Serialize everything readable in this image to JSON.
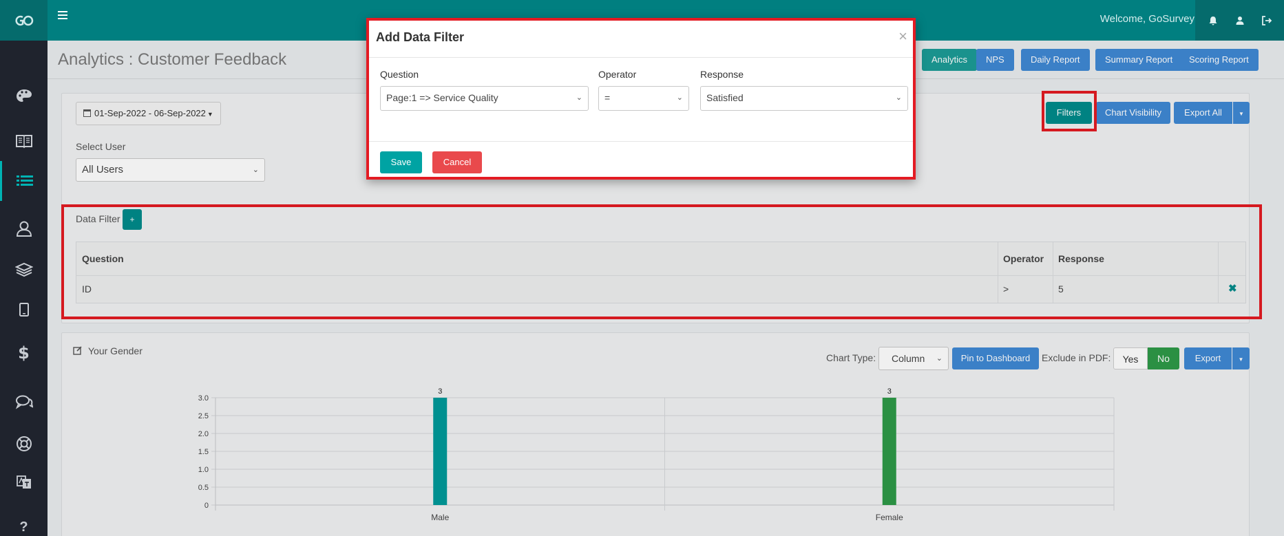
{
  "header": {
    "welcome": "Welcome, GoSurvey"
  },
  "sidebar": {
    "items": [
      {
        "icon": "palette-icon"
      },
      {
        "icon": "book-icon"
      },
      {
        "icon": "list-icon",
        "active": true
      },
      {
        "icon": "user-icon"
      },
      {
        "icon": "layers-icon"
      },
      {
        "icon": "tablet-icon"
      },
      {
        "icon": "dollar-icon"
      },
      {
        "icon": "chat-icon"
      },
      {
        "icon": "lifebuoy-icon"
      },
      {
        "icon": "translate-icon"
      },
      {
        "icon": "question-icon"
      }
    ]
  },
  "page": {
    "title": "Analytics : Customer Feedback",
    "buttons": {
      "analytics": "Analytics",
      "nps": "NPS",
      "daily_report": "Daily Report",
      "summary_report": "Summary Report",
      "scoring_report": "Scoring Report"
    }
  },
  "filters_panel": {
    "date_range": "01-Sep-2022 - 06-Sep-2022",
    "select_user_label": "Select User",
    "select_user_value": "All Users",
    "filters_btn": "Filters",
    "chart_visibility_btn": "Chart Visibility",
    "export_all_btn": "Export All",
    "data_filter_label": "Data Filter",
    "add_btn": "+",
    "table": {
      "headers": [
        "Question",
        "Operator",
        "Response"
      ],
      "rows": [
        {
          "question": "ID",
          "operator": ">",
          "response": "5"
        }
      ]
    }
  },
  "chart_panel": {
    "title": "Your Gender",
    "chart_type_label": "Chart Type:",
    "chart_type_value": "Column",
    "pin_btn": "Pin to Dashboard",
    "exclude_label": "Exclude in PDF:",
    "yes": "Yes",
    "no": "No",
    "export_btn": "Export"
  },
  "chart_data": {
    "type": "bar",
    "categories": [
      "Male",
      "Female"
    ],
    "values": [
      3,
      3
    ],
    "colors": [
      "#009999",
      "#2e9a48"
    ],
    "ylim": [
      0,
      3
    ],
    "yticks": [
      "3.0",
      "2.5",
      "2.0",
      "1.5",
      "1.0",
      "0.5",
      "0"
    ],
    "ytick_values": [
      3,
      2.5,
      2,
      1.5,
      1,
      0.5,
      0
    ],
    "data_labels": [
      "3",
      "3"
    ]
  },
  "modal": {
    "title": "Add Data Filter",
    "close": "×",
    "question_label": "Question",
    "question_value": "Page:1 => Service Quality",
    "operator_label": "Operator",
    "operator_value": "=",
    "response_label": "Response",
    "response_value": "Satisfied",
    "save": "Save",
    "cancel": "Cancel"
  },
  "colors": {
    "primary": "#017f80",
    "sidebar": "#1f232d",
    "blue_button": "#3f88d4",
    "danger": "#e9494c",
    "highlight": "#e31b23"
  }
}
